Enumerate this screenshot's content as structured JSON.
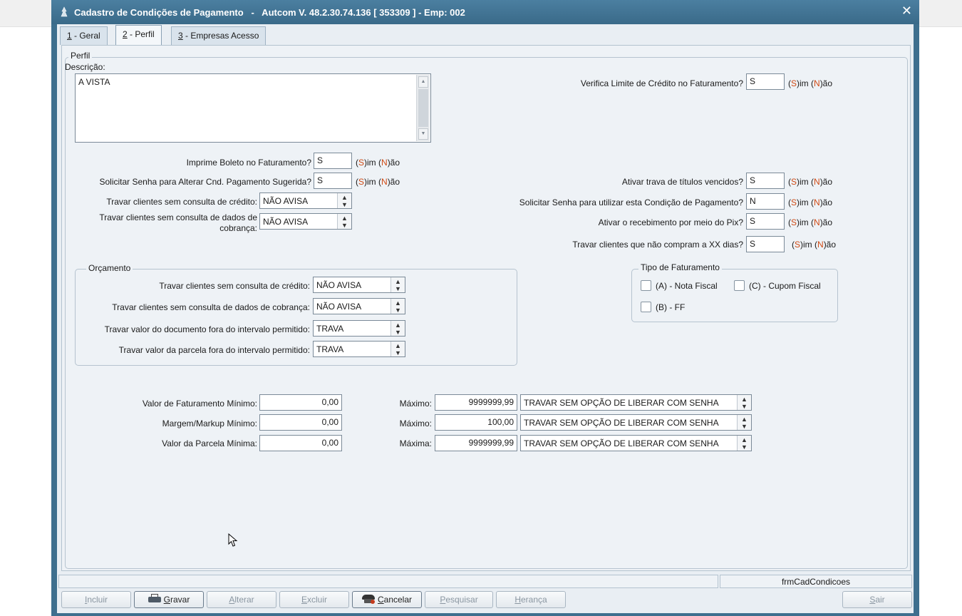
{
  "window": {
    "title": "Cadastro de Condições de Pagamento   -   Autcom V. 48.2.30.74.136 [ 353309 ] - Emp: 002",
    "close_label": "✕"
  },
  "tabs": [
    {
      "key": "1",
      "label": " - Geral"
    },
    {
      "key": "2",
      "label": " - Perfil"
    },
    {
      "key": "3",
      "label": " - Empresas Acesso"
    }
  ],
  "perfil": {
    "legend": "Perfil",
    "descricao_label": "Descrição:",
    "descricao_value": "A VISTA",
    "imprime_boleto": {
      "label": "Imprime Boleto no Faturamento?",
      "value": "S"
    },
    "solicitar_senha_cnd": {
      "label": "Solicitar Senha para Alterar Cnd. Pagamento Sugerida?",
      "value": "S"
    },
    "travar_consulta_credito": {
      "label": "Travar clientes sem consulta de crédito:",
      "value": "NÃO AVISA"
    },
    "travar_consulta_cobranca": {
      "label1": "Travar clientes sem consulta de dados de",
      "label2": "cobrança:",
      "value": "NÃO AVISA"
    },
    "verifica_limite": {
      "label": "Verifica Limite de Crédito no Faturamento?",
      "value": "S"
    },
    "ativar_trava_titulos": {
      "label": "Ativar trava de títulos vencidos?",
      "value": "S"
    },
    "solicitar_senha_condicao": {
      "label": "Solicitar Senha para utilizar esta Condição de Pagamento?",
      "value": "N"
    },
    "ativar_pix": {
      "label": "Ativar o recebimento por meio do Pix?",
      "value": "S"
    },
    "travar_xx_dias": {
      "label": "Travar clientes que não compram a XX dias?",
      "value": "S"
    }
  },
  "sn_hint": {
    "p1": "(",
    "s": "S",
    "p2": ")im (",
    "n": "N",
    "p3": ")ão"
  },
  "orcamento": {
    "legend": "Orçamento",
    "rows": [
      {
        "label": "Travar clientes sem consulta de crédito:",
        "value": "NÃO AVISA"
      },
      {
        "label": "Travar clientes sem consulta de dados de cobrança:",
        "value": "NÃO AVISA"
      },
      {
        "label": "Travar valor do documento fora do intervalo permitido:",
        "value": "TRAVA"
      },
      {
        "label": "Travar valor da parcela fora do intervalo permitido:",
        "value": "TRAVA"
      }
    ]
  },
  "tipo_faturamento": {
    "legend": "Tipo de Faturamento",
    "options": [
      {
        "label": "(A) - Nota Fiscal",
        "checked": false
      },
      {
        "label": "(C) - Cupom Fiscal",
        "checked": false
      },
      {
        "label": "(B) - FF",
        "checked": false
      }
    ]
  },
  "valores": [
    {
      "label": "Valor de Faturamento Mínimo:",
      "min": "0,00",
      "max_label": "Máximo:",
      "max": "9999999,99",
      "acao": "TRAVAR SEM OPÇÃO DE LIBERAR COM SENHA"
    },
    {
      "label": "Margem/Markup Mínimo:",
      "min": "0,00",
      "max_label": "Máximo:",
      "max": "100,00",
      "acao": "TRAVAR SEM OPÇÃO DE LIBERAR COM SENHA"
    },
    {
      "label": "Valor da Parcela Mínima:",
      "min": "0,00",
      "max_label": "Máxima:",
      "max": "9999999,99",
      "acao": "TRAVAR SEM OPÇÃO DE LIBERAR COM SENHA"
    }
  ],
  "status": {
    "form_name": "frmCadCondicoes"
  },
  "buttons": {
    "incluir": {
      "u": "I",
      "rest": "ncluir"
    },
    "gravar": {
      "u": "G",
      "rest": "ravar"
    },
    "alterar": {
      "u": "A",
      "rest": "lterar"
    },
    "excluir": {
      "u": "E",
      "rest": "xcluir"
    },
    "cancelar": {
      "u": "C",
      "rest": "ancelar"
    },
    "pesquisar": {
      "u": "P",
      "rest": "esquisar"
    },
    "heranca": {
      "u": "H",
      "rest": "erança"
    },
    "sair": {
      "u": "S",
      "rest": "air"
    }
  },
  "colors": {
    "title_bar": "#3e6f8e",
    "accent_orange": "#d04a14",
    "panel": "#eef2f6"
  }
}
